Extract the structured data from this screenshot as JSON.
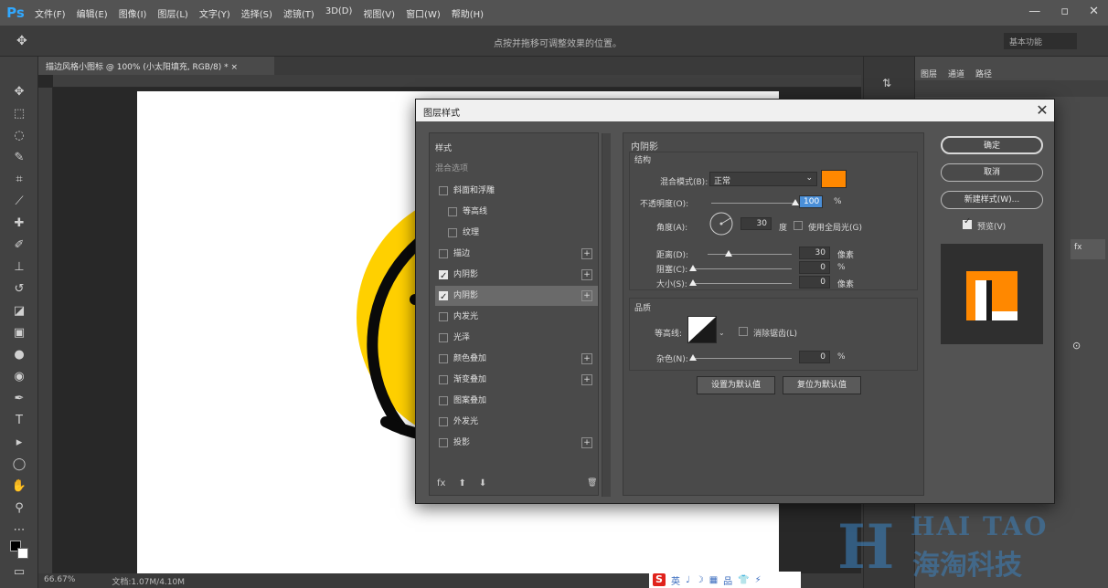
{
  "app": {
    "logo": "Ps",
    "menus": [
      "文件(F)",
      "编辑(E)",
      "图像(I)",
      "图层(L)",
      "文字(Y)",
      "选择(S)",
      "滤镜(T)",
      "3D(D)",
      "视图(V)",
      "窗口(W)",
      "帮助(H)"
    ],
    "window_controls": [
      "—",
      "▫",
      "✕"
    ]
  },
  "options_bar": {
    "hint": "点按并拖移可调整效果的位置。",
    "search_placeholder": "基本功能"
  },
  "document": {
    "tab_label": "描边风格小图标 @ 100% (小太阳填充, RGB/8) * ×",
    "status_zoom": "66.67%",
    "status_info": "文档:1.07M/4.10M"
  },
  "right_panel": {
    "tabs": [
      "图层",
      "通道",
      "路径"
    ]
  },
  "dialog": {
    "title": "图层样式",
    "close": "✕",
    "styles_header": "样式",
    "blend_options": "混合选项",
    "styles": [
      {
        "label": "斜面和浮雕",
        "checked": false,
        "plus": false,
        "indent": 0
      },
      {
        "label": "等高线",
        "checked": false,
        "plus": false,
        "indent": 1
      },
      {
        "label": "纹理",
        "checked": false,
        "plus": false,
        "indent": 1
      },
      {
        "label": "描边",
        "checked": false,
        "plus": true,
        "indent": 0
      },
      {
        "label": "内阴影",
        "checked": true,
        "plus": true,
        "indent": 0
      },
      {
        "label": "内阴影",
        "checked": true,
        "plus": true,
        "indent": 0,
        "selected": true
      },
      {
        "label": "内发光",
        "checked": false,
        "plus": false,
        "indent": 0
      },
      {
        "label": "光泽",
        "checked": false,
        "plus": false,
        "indent": 0
      },
      {
        "label": "颜色叠加",
        "checked": false,
        "plus": true,
        "indent": 0
      },
      {
        "label": "渐变叠加",
        "checked": false,
        "plus": true,
        "indent": 0
      },
      {
        "label": "图案叠加",
        "checked": false,
        "plus": false,
        "indent": 0
      },
      {
        "label": "外发光",
        "checked": false,
        "plus": false,
        "indent": 0
      },
      {
        "label": "投影",
        "checked": false,
        "plus": true,
        "indent": 0
      }
    ],
    "footer_icons": [
      "fx",
      "⬆",
      "⬇",
      "🗑"
    ],
    "section_title": "内阴影",
    "structure_title": "结构",
    "blend_mode_label": "混合模式(B):",
    "blend_mode_value": "正常",
    "blend_color": "#ff8800",
    "opacity_label": "不透明度(O):",
    "opacity_value": "100",
    "opacity_unit": "%",
    "opacity_fraction": 1.0,
    "angle_label": "角度(A):",
    "angle_value": "30",
    "angle_unit": "度",
    "global_light_label": "使用全局光(G)",
    "distance_label": "距离(D):",
    "distance_value": "30",
    "distance_unit": "像素",
    "distance_fraction": 0.25,
    "choke_label": "阻塞(C):",
    "choke_value": "0",
    "choke_unit": "%",
    "choke_fraction": 0,
    "size_label": "大小(S):",
    "size_value": "0",
    "size_unit": "像素",
    "size_fraction": 0,
    "quality_title": "品质",
    "contour_label": "等高线:",
    "antialias_label": "消除锯齿(L)",
    "noise_label": "杂色(N):",
    "noise_value": "0",
    "noise_unit": "%",
    "noise_fraction": 0,
    "make_default": "设置为默认值",
    "reset_default": "复位为默认值",
    "ok": "确定",
    "cancel": "取消",
    "new_style": "新建样式(W)...",
    "preview_label": "预览(V)"
  },
  "watermark": {
    "en": "HAI TAO",
    "cn": "海淘科技"
  },
  "ime": {
    "logo": "S",
    "glyphs": [
      "英",
      "♩",
      "☽",
      "▦",
      "品",
      "👕",
      "⚡"
    ]
  },
  "colors": {
    "canvas_yellow": "#ffd000",
    "accent_orange": "#ff8800",
    "accent_blue": "#31a8ff"
  }
}
